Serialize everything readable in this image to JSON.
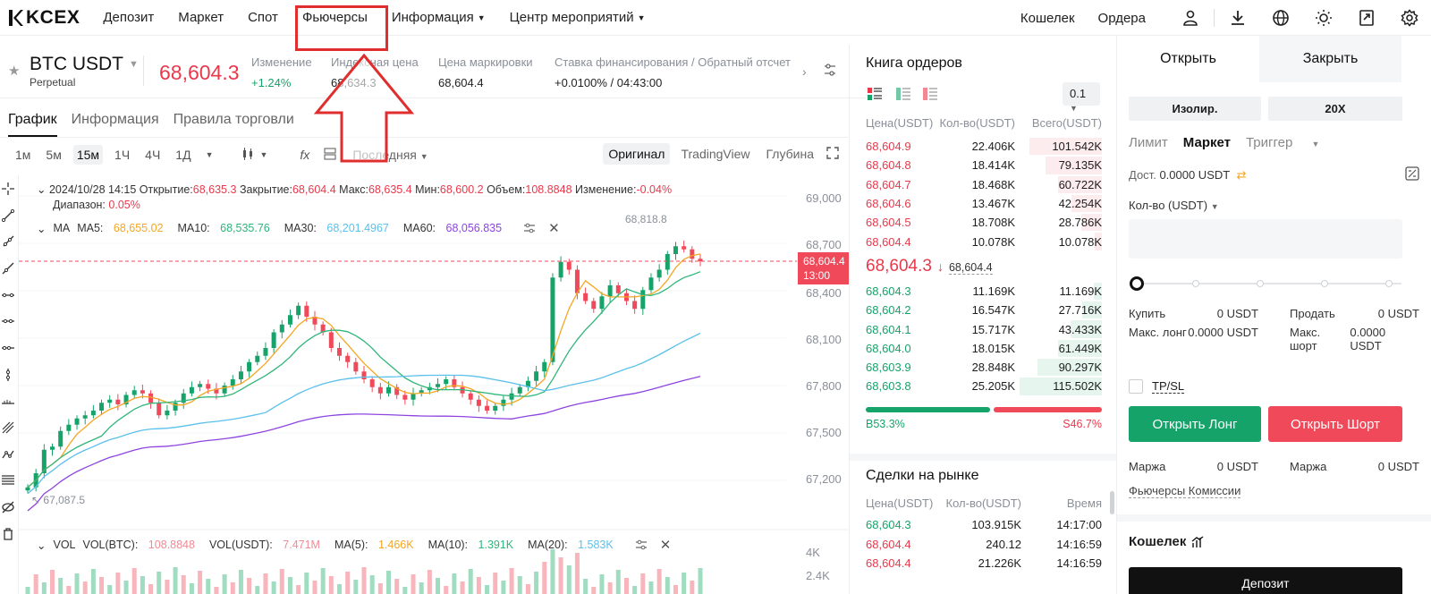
{
  "nav": {
    "logo": "KCEX",
    "items": [
      {
        "label": "Депозит",
        "dropdown": false
      },
      {
        "label": "Маркет",
        "dropdown": false
      },
      {
        "label": "Спот",
        "dropdown": false
      },
      {
        "label": "Фьючерсы",
        "dropdown": false
      },
      {
        "label": "Информация",
        "dropdown": true
      },
      {
        "label": "Центр мероприятий",
        "dropdown": true
      }
    ],
    "right": {
      "wallet": "Кошелек",
      "orders": "Ордера"
    },
    "icons": [
      "user-icon",
      "download-icon",
      "globe-icon",
      "theme-icon",
      "assets-icon",
      "settings-icon"
    ]
  },
  "ticker": {
    "pair": "BTC USDT",
    "type": "Perpetual",
    "last_price": "68,604.3",
    "change_label": "Изменение",
    "change_value": "+1.24%",
    "index_label": "Индексная цена",
    "index_value": "68,634.3",
    "mark_label": "Цена маркировки",
    "mark_value": "68,604.4",
    "funding_label": "Ставка финансирования",
    "countdown_label": "Обратный отсчет",
    "funding_value": "+0.0100%",
    "countdown_value": "04:43:00"
  },
  "chart_tabs": [
    "График",
    "Информация",
    "Правила торговли"
  ],
  "toolbar": {
    "timeframes": [
      "1м",
      "5м",
      "15м",
      "1Ч",
      "4Ч",
      "1Д"
    ],
    "active_tf": "15м",
    "price_type": "Последняя",
    "views": [
      "Оригинал",
      "TradingView",
      "Глубина"
    ],
    "active_view": "Оригинал"
  },
  "ohlc": {
    "date": "2024/10/28 14:15",
    "open_label": "Открытие:",
    "open": "68,635.3",
    "close_label": "Закрытие:",
    "close": "68,604.4",
    "high_label": "Макс:",
    "high": "68,635.4",
    "low_label": "Мин:",
    "low": "68,600.2",
    "vol_label": "Объем:",
    "vol": "108.8848",
    "chg_label": "Изменение:",
    "chg": "-0.04%",
    "range_label": "Диапазон:",
    "range": "0.05%"
  },
  "ma": {
    "label": "MA",
    "ma5_label": "MA5:",
    "ma5": "68,655.02",
    "ma5_color": "#f5a623",
    "ma10_label": "MA10:",
    "ma10": "68,535.76",
    "ma10_color": "#2fb57a",
    "ma30_label": "MA30:",
    "ma30": "68,201.4967",
    "ma30_color": "#5bc0eb",
    "ma60_label": "MA60:",
    "ma60": "68,056.835",
    "ma60_color": "#8e44e0"
  },
  "vol": {
    "label": "VOL",
    "btc_label": "VOL(BTC):",
    "btc": "108.8848",
    "usdt_label": "VOL(USDT):",
    "usdt": "7.471M",
    "ma5_label": "MA(5):",
    "ma5": "1.466K",
    "ma10_label": "MA(10):",
    "ma10": "1.391K",
    "ma20_label": "MA(20):",
    "ma20": "1.583K"
  },
  "chart_data": {
    "type": "candlestick",
    "y_ticks": [
      "69,000",
      "68,700",
      "68,400",
      "68,100",
      "67,800",
      "67,500",
      "67,200"
    ],
    "vol_ticks": [
      "4K",
      "2.4K"
    ],
    "last_price_tag": "68,604.4",
    "countdown_tag": "13:00",
    "high_marker": "68,818.8",
    "low_marker": "67,087.5",
    "ylim": [
      67050,
      69050
    ],
    "series_close": [
      67160,
      67250,
      67400,
      67420,
      67520,
      67560,
      67600,
      67620,
      67650,
      67700,
      67720,
      67690,
      67750,
      67780,
      67760,
      67700,
      67620,
      67650,
      67700,
      67760,
      67800,
      67820,
      67790,
      67760,
      67810,
      67850,
      67900,
      67960,
      68000,
      68050,
      68150,
      68200,
      68260,
      68320,
      68250,
      68200,
      68150,
      68050,
      68000,
      67960,
      67900,
      67850,
      67800,
      67760,
      67800,
      67750,
      67720,
      67760,
      67780,
      67800,
      67820,
      67850,
      67800,
      67760,
      67720,
      67680,
      67650,
      67680,
      67720,
      67760,
      67800,
      67840,
      67900,
      67960,
      68500,
      68600,
      68550,
      68400,
      68350,
      68300,
      68380,
      68450,
      68400,
      68350,
      68300,
      68420,
      68500,
      68550,
      68650,
      68700,
      68680,
      68620,
      68604
    ]
  },
  "orderbook": {
    "title": "Книга ордеров",
    "step": "0.1",
    "headers": [
      "Цена(USDT)",
      "Кол-во(USDT)",
      "Всего(USDT)"
    ],
    "asks": [
      [
        "68,604.9",
        "22.406K",
        "101.542K",
        0.88
      ],
      [
        "68,604.8",
        "18.414K",
        "79.135K",
        0.69
      ],
      [
        "68,604.7",
        "18.468K",
        "60.722K",
        0.53
      ],
      [
        "68,604.6",
        "13.467K",
        "42.254K",
        0.37
      ],
      [
        "68,604.5",
        "18.708K",
        "28.786K",
        0.25
      ],
      [
        "68,604.4",
        "10.078K",
        "10.078K",
        0.09
      ]
    ],
    "mid_price": "68,604.3",
    "mid_index": "68,604.4",
    "bids": [
      [
        "68,604.3",
        "11.169K",
        "11.169K",
        0.1
      ],
      [
        "68,604.2",
        "16.547K",
        "27.716K",
        0.24
      ],
      [
        "68,604.1",
        "15.717K",
        "43.433K",
        0.38
      ],
      [
        "68,604.0",
        "18.015K",
        "61.449K",
        0.53
      ],
      [
        "68,603.9",
        "28.848K",
        "90.297K",
        0.78
      ],
      [
        "68,603.8",
        "25.205K",
        "115.502K",
        1.0
      ]
    ],
    "buy_ratio": "B53.3%",
    "sell_ratio": "S46.7%"
  },
  "trades": {
    "title": "Сделки на рынке",
    "headers": [
      "Цена(USDT)",
      "Кол-во(USDT)",
      "Время"
    ],
    "rows": [
      [
        "68,604.3",
        "103.915K",
        "14:17:00"
      ],
      [
        "68,604.4",
        "240.12",
        "14:16:59"
      ],
      [
        "68,604.4",
        "21.226K",
        "14:16:59"
      ]
    ]
  },
  "trade_panel": {
    "tab_open": "Открыть",
    "tab_close": "Закрыть",
    "margin_mode": "Изолир.",
    "leverage": "20X",
    "order_types": [
      "Лимит",
      "Маркет",
      "Триггер"
    ],
    "active_type": "Маркет",
    "available_label": "Дост.",
    "available_value": "0.0000 USDT",
    "qty_label": "Кол-во (USDT)",
    "qty_value": "",
    "buy_label": "Купить",
    "buy_value": "0 USDT",
    "sell_label": "Продать",
    "sell_value": "0 USDT",
    "max_long_label": "Макс. лонг",
    "max_long_value": "0.0000 USDT",
    "max_short_label": "Макс. шорт",
    "max_short_value": "0.0000 USDT",
    "tpsl": "TP/SL",
    "open_long": "Открыть Лонг",
    "open_short": "Открыть Шорт",
    "margin_label": "Маржа",
    "margin_long": "0 USDT",
    "margin_short": "0 USDT",
    "fees_link": "Фьючерсы Комиссии",
    "wallet_title": "Кошелек",
    "deposit": "Депозит"
  }
}
